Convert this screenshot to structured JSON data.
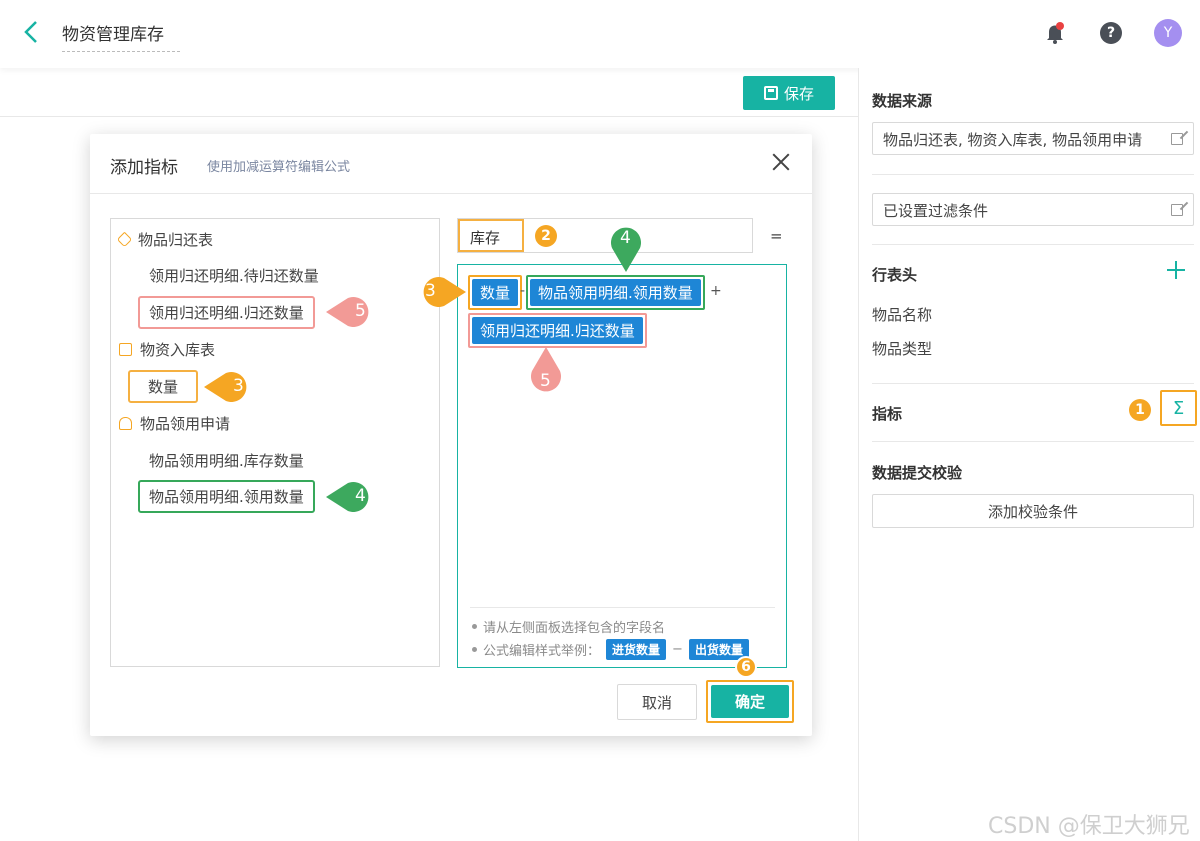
{
  "header": {
    "title": "物资管理库存",
    "avatar_initial": "Y",
    "help_glyph": "?"
  },
  "toolbar": {
    "save_label": "保存"
  },
  "right_panel": {
    "data_source_title": "数据来源",
    "data_source_value": "物品归还表, 物资入库表, 物品领用申请",
    "filter_value": "已设置过滤条件",
    "row_header_title": "行表头",
    "row_header_items": [
      "物品名称",
      "物品类型"
    ],
    "indicator_title": "指标",
    "sigma_glyph": "Σ",
    "validation_title": "数据提交校验",
    "add_validation_label": "添加校验条件"
  },
  "dialog": {
    "title": "添加指标",
    "subtitle": "使用加减运算符编辑公式",
    "groups": [
      {
        "name": "物品归还表",
        "icon": "tag-icon",
        "fields": [
          "领用归还明细.待归还数量",
          "领用归还明细.归还数量"
        ]
      },
      {
        "name": "物资入库表",
        "icon": "document-icon",
        "fields": [
          "数量"
        ]
      },
      {
        "name": "物品领用申请",
        "icon": "stamp-icon",
        "fields": [
          "物品领用明细.库存数量",
          "物品领用明细.领用数量"
        ]
      }
    ],
    "indicator_name": "库存",
    "equals": "=",
    "formula_tokens": [
      "数量",
      "物品领用明细.领用数量",
      "领用归还明细.归还数量"
    ],
    "operators": [
      "-",
      "+"
    ],
    "hints": [
      "请从左侧面板选择包含的字段名",
      "公式编辑样式举例："
    ],
    "example_tokens": [
      "进货数量",
      "出货数量"
    ],
    "example_operator": "−",
    "cancel_label": "取消",
    "ok_label": "确定"
  },
  "callouts": {
    "one": "1",
    "two": "2",
    "three": "3",
    "four": "4",
    "five": "5",
    "six": "6"
  },
  "watermark": "CSDN @保卫大狮兄",
  "colors": {
    "accent": "#17b3a3",
    "token_blue": "#1e86d6",
    "callout_orange": "#f5a623",
    "callout_green": "#3da95e",
    "callout_red": "#f29a96"
  }
}
